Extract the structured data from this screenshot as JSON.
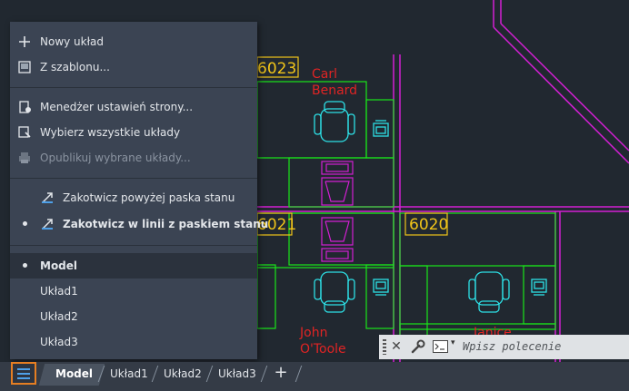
{
  "menu": {
    "items": [
      {
        "label": "Nowy układ",
        "icon": "plus-icon"
      },
      {
        "label": "Z szablonu...",
        "icon": "template-icon"
      },
      {
        "label": "Menedżer ustawień strony...",
        "icon": "page-setup-icon"
      },
      {
        "label": "Wybierz wszystkie układy",
        "icon": "select-layouts-icon"
      },
      {
        "label": "Opublikuj wybrane układy...",
        "icon": "printer-icon",
        "disabled": true
      },
      {
        "label": "Zakotwicz powyżej paska stanu",
        "icon": "dock-icon"
      },
      {
        "label": "Zakotwicz w linii z paskiem stanu",
        "icon": "dock-inline-icon",
        "selected": true
      },
      {
        "label": "Model",
        "selected": true
      },
      {
        "label": "Układ1"
      },
      {
        "label": "Układ2"
      },
      {
        "label": "Układ3"
      }
    ]
  },
  "drawing": {
    "room_numbers": [
      "6023",
      "6021",
      "6020"
    ],
    "names": [
      {
        "line1": "Carl",
        "line2": "Benard"
      },
      {
        "line1": "John",
        "line2": "O'Toole"
      },
      {
        "line1": "Janice",
        "line2": ""
      }
    ],
    "colors": {
      "magenta": "#d21fd2",
      "green": "#19e619",
      "cyan": "#2de0e6",
      "yellow": "#f0c419",
      "red": "#e02424",
      "background": "#212830"
    }
  },
  "command_line": {
    "placeholder": "Wpisz polecenie",
    "close_label": "✕"
  },
  "tabs": {
    "items": [
      {
        "label": "Model",
        "active": true
      },
      {
        "label": "Układ1"
      },
      {
        "label": "Układ2"
      },
      {
        "label": "Układ3"
      }
    ],
    "add_label": "+"
  }
}
